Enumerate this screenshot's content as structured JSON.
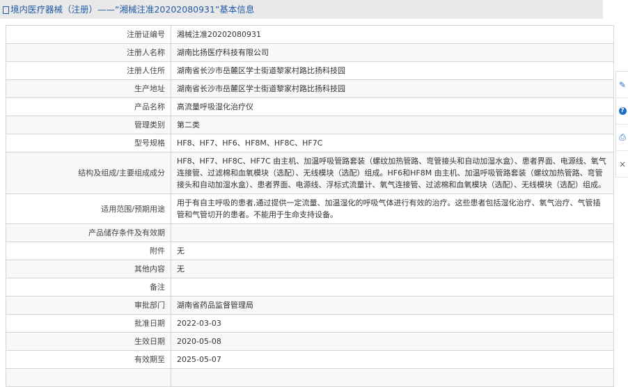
{
  "title": "境内医疗器械（注册）——“湘械注准20202080931”基本信息",
  "rows": [
    {
      "label": "注册证编号",
      "value": "湘械注准20202080931"
    },
    {
      "label": "注册人名称",
      "value": "湖南比扬医疗科技有限公司"
    },
    {
      "label": "注册人住所",
      "value": "湖南省长沙市岳麓区学士街道黎家村路比扬科技园"
    },
    {
      "label": "生产地址",
      "value": "湖南省长沙市岳麓区学士街道黎家村路比扬科技园"
    },
    {
      "label": "产品名称",
      "value": "高流量呼吸湿化治疗仪"
    },
    {
      "label": "管理类别",
      "value": "第二类"
    },
    {
      "label": "型号规格",
      "value": "HF8、HF7、HF6、HF8M、HF8C、HF7C"
    },
    {
      "label": "结构及组成/主要组成成分",
      "value": "HF8、HF7、HF8C、HF7C 由主机、加温呼吸管路套装（螺纹加热管路、弯管接头和自动加湿水盒）、患者界面、电源线、氧气连接管、过滤棉和血氧模块（选配）、无线模块（选配）组成。HF6和HF8M 由主机、加温呼吸管路套装（螺纹加热管路、弯管接头和自动加湿水盒）、患者界面、电源线、浮标式流量计、氧气连接管、过滤棉和血氧模块（选配）、无线模块（选配）组成。"
    },
    {
      "label": "适用范围/预期用途",
      "value": "用于有自主呼吸的患者,通过提供一定流量、加温湿化的呼吸气体进行有效的治疗。这些患者包括湿化治疗、氧气治疗、气管插管和气管切开的患者。不能用于生命支持设备。"
    },
    {
      "label": "产品储存条件及有效期",
      "value": ""
    },
    {
      "label": "附件",
      "value": "无"
    },
    {
      "label": "其他内容",
      "value": "无"
    },
    {
      "label": "备注",
      "value": ""
    },
    {
      "label": "审批部门",
      "value": "湖南省药品监督管理局"
    },
    {
      "label": "批准日期",
      "value": "2022-03-03"
    },
    {
      "label": "生效日期",
      "value": "2020-05-08"
    },
    {
      "label": "有效期至",
      "value": "2025-05-07"
    },
    {
      "label": "",
      "value": ""
    }
  ],
  "side_icons": [
    "edit-icon",
    "help-icon",
    "print-icon",
    "close-icon"
  ],
  "side_glyphs": {
    "edit": "✎",
    "help": "?",
    "print": "⎙",
    "close": "×"
  }
}
